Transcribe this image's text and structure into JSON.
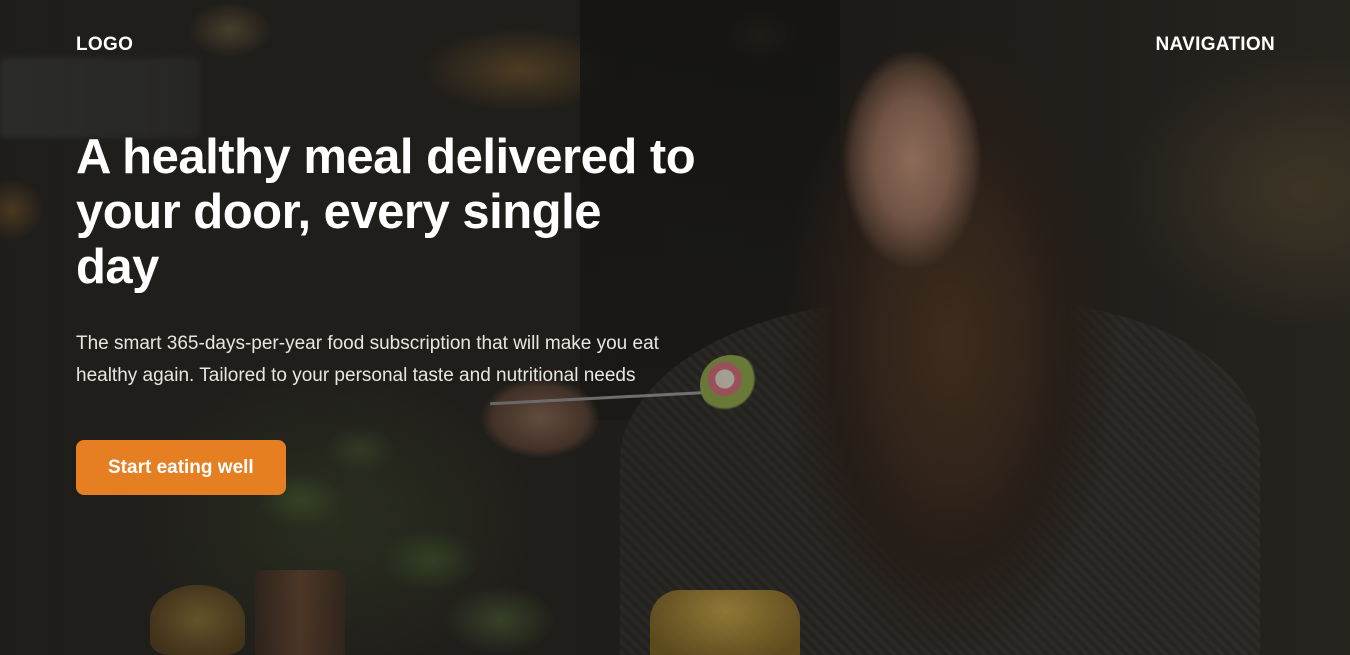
{
  "header": {
    "logo": "LOGO",
    "navigation": "NAVIGATION"
  },
  "hero": {
    "title": "A healthy meal delivered to your door, every single day",
    "description": "The smart 365-days-per-year food subscription that will make you eat healthy again. Tailored to your personal taste and nutritional needs",
    "cta_label": "Start eating well"
  },
  "colors": {
    "accent": "#e67e22",
    "text": "#ffffff"
  }
}
